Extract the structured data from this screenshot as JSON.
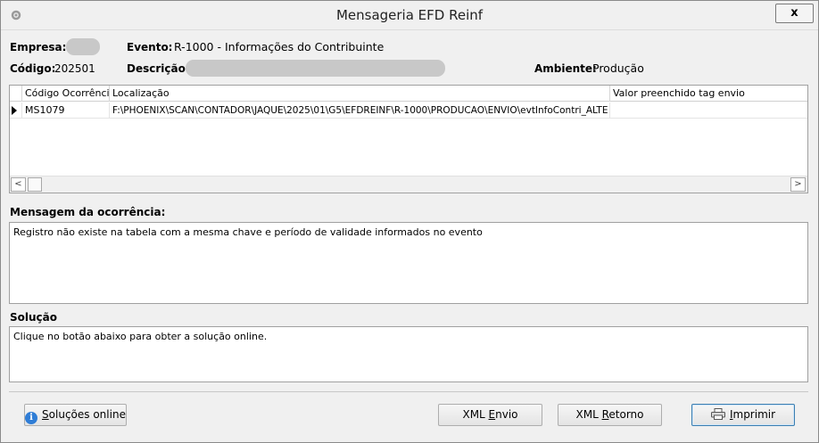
{
  "window": {
    "title": "Mensageria EFD Reinf",
    "close_label": "x"
  },
  "header": {
    "empresa_label": "Empresa:",
    "evento_label": "Evento:",
    "evento_value": "R-1000 - Informações do Contribuinte",
    "codigo_label": "Código:",
    "codigo_value": "202501",
    "descricao_label": "Descrição:",
    "ambiente_label": "Ambiente:",
    "ambiente_value": "Produção"
  },
  "grid": {
    "columns": [
      "Código Ocorrência",
      "Localização",
      "Valor preenchido tag envio"
    ],
    "rows": [
      {
        "codigo": "MS1079",
        "localizacao": "F:\\PHOENIX\\SCAN\\CONTADOR\\JAQUE\\2025\\01\\G5\\EFDREINF\\R-1000\\PRODUCAO\\ENVIO\\evtInfoContri_ALTE",
        "valor": ""
      }
    ],
    "scroll_left": "<",
    "scroll_right": ">"
  },
  "mensagem": {
    "title": "Mensagem da ocorrência:",
    "text": "Registro não existe na tabela com a mesma chave e período de validade informados no evento"
  },
  "solucao": {
    "title": "Solução",
    "text": "Clique no botão abaixo para obter a solução online."
  },
  "buttons": {
    "solucoes_online": {
      "accel": "S",
      "rest": "oluções online"
    },
    "xml_envio": {
      "pre": "XML ",
      "accel": "E",
      "rest": "nvio"
    },
    "xml_retorno": {
      "pre": "XML ",
      "accel": "R",
      "rest": "etorno"
    },
    "imprimir": {
      "accel": "I",
      "rest": "mprimir"
    }
  },
  "icons": {
    "app": "gear-icon",
    "info": "info-icon",
    "print": "printer-icon"
  },
  "colors": {
    "window_bg": "#f0f0f0",
    "info_blue": "#2f7dd6",
    "focus_border": "#3c7fb1"
  }
}
